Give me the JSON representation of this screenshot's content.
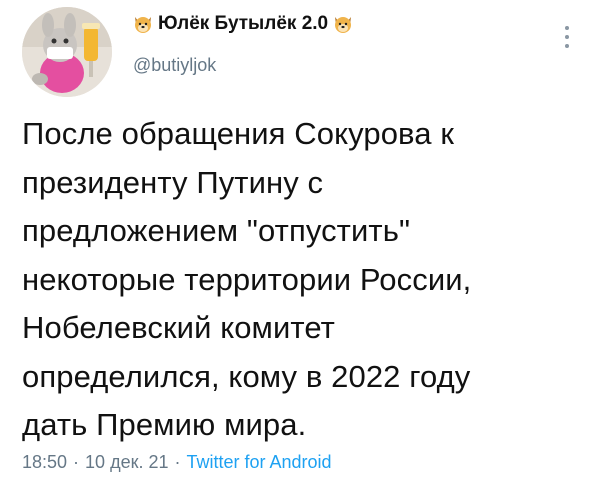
{
  "author": {
    "display_name": "Юлёк Бутылёк 2.0",
    "handle": "@butiyljok",
    "name_emoji": "dog-face-icon",
    "avatar": "avatar"
  },
  "tweet": {
    "lines": [
      "После обращения Сокурова к",
      "президенту Путину с",
      "предложением \"отпустить\"",
      "некоторые территории России,",
      "Нобелевский комитет",
      "определился, кому в 2022 году",
      "дать Премию мира."
    ]
  },
  "meta": {
    "time": "18:50",
    "date": "10 дек. 21",
    "separator": "·",
    "source": "Twitter for Android"
  },
  "colors": {
    "text": "#111111",
    "secondary": "#657786",
    "link": "#1da1f2"
  }
}
